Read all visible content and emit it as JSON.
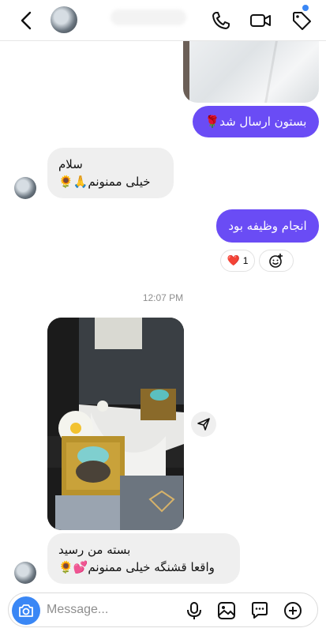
{
  "messages": {
    "out_1": "بستون ارسال شد🌹",
    "in_1": {
      "line1": "سلام",
      "line2": "خیلی ممنونم🙏🌻"
    },
    "out_2": "انجام وظیفه بود",
    "reaction": {
      "emoji": "❤️",
      "count": "1"
    },
    "timestamp": "12:07 PM",
    "in_2": {
      "line1": "بسته من رسید",
      "line2": "واقعا قشنگه خیلی ممنونم💕🌻"
    }
  },
  "composer": {
    "placeholder": "Message..."
  },
  "colors": {
    "outgoing": "#6a4cf5",
    "incoming": "#efefef",
    "accent": "#3a87f5"
  },
  "icons": [
    "back-arrow-icon",
    "phone-icon",
    "video-camera-icon",
    "tag-icon",
    "add-reaction-icon",
    "share-icon",
    "camera-icon",
    "microphone-icon",
    "gallery-icon",
    "sticker-icon",
    "plus-icon"
  ]
}
